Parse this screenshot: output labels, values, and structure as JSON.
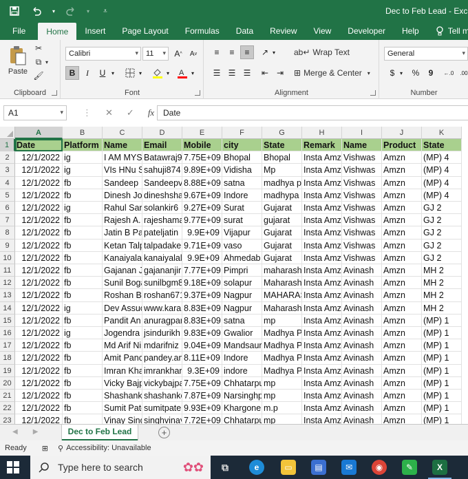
{
  "title": "Dec to Feb Lead  -  Excel",
  "quick_access": {
    "save_icon": "save-icon",
    "undo_icon": "undo-icon",
    "redo_icon": "redo-icon",
    "customize_icon": "customize-qat-icon"
  },
  "tabs": [
    "File",
    "Home",
    "Insert",
    "Page Layout",
    "Formulas",
    "Data",
    "Review",
    "View",
    "Developer",
    "Help"
  ],
  "active_tab": "Home",
  "tell_me": "Tell me wha",
  "ribbon": {
    "clipboard": {
      "label": "Clipboard",
      "paste": "Paste"
    },
    "font": {
      "label": "Font",
      "name": "Calibri",
      "size": "11",
      "bold": "B",
      "italic": "I",
      "underline": "U",
      "grow": "A",
      "shrink": "A"
    },
    "alignment": {
      "label": "Alignment",
      "wrap_text": "Wrap Text",
      "merge_center": "Merge & Center"
    },
    "number": {
      "label": "Number",
      "format": "General",
      "currency": "$",
      "percent": "%",
      "comma": "9"
    }
  },
  "formula_bar": {
    "name_box": "A1",
    "fx": "fx",
    "formula": "Date"
  },
  "columns": [
    "A",
    "B",
    "C",
    "D",
    "E",
    "F",
    "G",
    "H",
    "I",
    "J",
    "K"
  ],
  "headers": [
    "Date",
    "Platform",
    "Name",
    "Email",
    "Mobile",
    "city",
    "State",
    "Remark",
    "Name",
    "Product",
    "State"
  ],
  "rows": [
    [
      "12/1/2022",
      "ig",
      "I AM MYST",
      "Batawraj9",
      "7.75E+09",
      "Bhopal",
      "Bhopal",
      "Insta Amz",
      "Vishwas",
      "Amzn",
      "(MP) 4"
    ],
    [
      "12/1/2022",
      "ig",
      "VIs HNu S",
      "sahuji874",
      "9.89E+09",
      "Vidisha",
      "Mp",
      "Insta Amz",
      "Vishwas",
      "Amzn",
      "(MP) 4"
    ],
    [
      "12/1/2022",
      "fb",
      "Sandeep",
      "Sandeepv",
      "8.88E+09",
      "satna",
      "madhya p",
      "Insta Amz",
      "Vishwas",
      "Amzn",
      "(MP) 4"
    ],
    [
      "12/1/2022",
      "fb",
      "Dinesh Jo",
      "dineshsha",
      "9.67E+09",
      "Indore",
      "madhypa",
      "Insta Amz",
      "Vishwas",
      "Amzn",
      "(MP) 4"
    ],
    [
      "12/1/2022",
      "ig",
      "Rahul Sar",
      "solankir6",
      "9.27E+09",
      "Surat",
      "Gujarat",
      "Insta Amz",
      "Vishwas",
      "Amzn",
      "GJ 2"
    ],
    [
      "12/1/2022",
      "fb",
      "Rajesh A.",
      "rajeshama",
      "9.77E+09",
      "surat",
      "gujarat",
      "Insta Amz",
      "Vishwas",
      "Amzn",
      "GJ 2"
    ],
    [
      "12/1/2022",
      "fb",
      "Jatin B Pa",
      "pateljatin",
      "9.9E+09",
      "Vijapur",
      "Gujarat",
      "Insta Amz",
      "Vishwas",
      "Amzn",
      "GJ 2"
    ],
    [
      "12/1/2022",
      "fb",
      "Ketan Talp",
      "talpadake",
      "9.71E+09",
      "vaso",
      "Gujarat",
      "Insta Amz",
      "Vishwas",
      "Amzn",
      "GJ 2"
    ],
    [
      "12/1/2022",
      "fb",
      "Kanaiyalal",
      "kanaiyalal",
      "9.9E+09",
      "Ahmedab",
      "Gujarat",
      "Insta Amz",
      "Vishwas",
      "Amzn",
      "GJ 2"
    ],
    [
      "12/1/2022",
      "fb",
      "Gajanan Ji",
      "gajananjir",
      "7.77E+09",
      "Pimpri",
      "maharash",
      "Insta Amz",
      "Avinash",
      "Amzn",
      "MH 2"
    ],
    [
      "12/1/2022",
      "fb",
      "Sunil Boga",
      "sunilbgm8",
      "9.18E+09",
      "solapur",
      "Maharash",
      "Insta Amz",
      "Avinash",
      "Amzn",
      "MH 2"
    ],
    [
      "12/1/2022",
      "fb",
      "Roshan Bu",
      "roshan671",
      "9.37E+09",
      "Nagpur",
      "MAHARAS",
      "Insta Amz",
      "Avinash",
      "Amzn",
      "MH 2"
    ],
    [
      "12/1/2022",
      "ig",
      "Dev Assuc",
      "www.kara",
      "8.83E+09",
      "Nagpur",
      "Maharash",
      "Insta Amz",
      "Avinash",
      "Amzn",
      "MH 2"
    ],
    [
      "12/1/2022",
      "fb",
      "Pandit An",
      "anuragpar",
      "8.83E+09",
      "satna",
      "mp",
      "Insta Amz",
      "Avinash",
      "Amzn",
      "(MP) 1"
    ],
    [
      "12/1/2022",
      "ig",
      "Jogendra",
      "jsindurikh",
      "9.83E+09",
      "Gwalior",
      "Madhya P",
      "Insta Amz",
      "Avinash",
      "Amzn",
      "(MP) 1"
    ],
    [
      "12/1/2022",
      "fb",
      "Md Arif Ni",
      "mdarifniz",
      "9.04E+09",
      "Mandsaur",
      "Madhya P",
      "Insta Amz",
      "Avinash",
      "Amzn",
      "(MP) 1"
    ],
    [
      "12/1/2022",
      "fb",
      "Amit Panc",
      "pandey.an",
      "8.11E+09",
      "Indore",
      "Madhya P",
      "Insta Amz",
      "Avinash",
      "Amzn",
      "(MP) 1"
    ],
    [
      "12/1/2022",
      "fb",
      "Imran Kha",
      "imrankhar",
      "9.3E+09",
      "indore",
      "Madhya P",
      "Insta Amz",
      "Avinash",
      "Amzn",
      "(MP) 1"
    ],
    [
      "12/1/2022",
      "fb",
      "Vicky Bajp",
      "vickybajpa",
      "7.75E+09",
      "Chhatarpu",
      "mp",
      "Insta Amz",
      "Avinash",
      "Amzn",
      "(MP) 1"
    ],
    [
      "12/1/2022",
      "fb",
      "Shashank",
      "shashanko",
      "7.87E+09",
      "Narsinghp",
      "mp",
      "Insta Amz",
      "Avinash",
      "Amzn",
      "(MP) 1"
    ],
    [
      "12/1/2022",
      "fb",
      "Sumit Pate",
      "sumitpate",
      "9.93E+09",
      "Khargone",
      "m.p",
      "Insta Amz",
      "Avinash",
      "Amzn",
      "(MP) 1"
    ],
    [
      "12/1/2022",
      "fb",
      "Vinay Sing",
      "singhvinay",
      "7.72E+09",
      "Chhatarpu",
      "mp",
      "Insta Amz",
      "Avinash",
      "Amzn",
      "(MP) 1"
    ]
  ],
  "sheet_tab": "Dec to Feb Lead",
  "add_sheet": "+",
  "status": {
    "ready": "Ready",
    "accessibility": "Accessibility: Unavailable"
  },
  "taskbar": {
    "search_placeholder": "Type here to search"
  }
}
